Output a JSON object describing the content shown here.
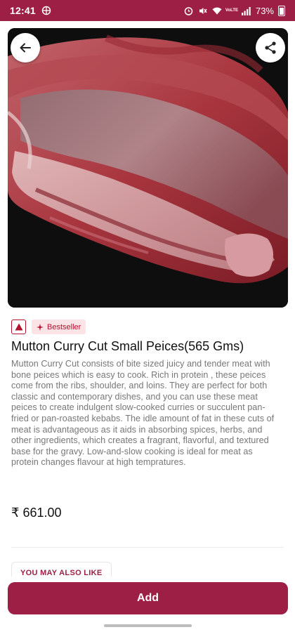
{
  "status_bar": {
    "time": "12:41",
    "battery": "73%",
    "icons": [
      "hotspot-icon",
      "alarm-icon",
      "mute-icon",
      "wifi-icon",
      "volte-icon",
      "signal-icon",
      "battery-icon"
    ]
  },
  "product": {
    "title": "Mutton Curry Cut Small Peices(565 Gms)",
    "badge": "Bestseller",
    "description": "Mutton Curry Cut consists of bite sized juicy and tender meat with bone peices which is easy to cook. Rich in protein , these peices come from the ribs, shoulder, and loins. They are perfect for both classic and contemporary dishes, and you can use these meat peices to create indulgent slow-cooked curries or succulent pan-fried or pan-roasted kebabs. The idle amount of fat in these cuts of meat is advantageous as it aids in absorbing spices, herbs, and other ingredients, which creates a fragrant, flavorful, and textured base for the gravy. Low-and-slow cooking is ideal for meat as protein changes flavour at high tempratures.",
    "price": "₹ 661.00"
  },
  "section": {
    "also_like": "YOU MAY ALSO LIKE"
  },
  "actions": {
    "add_label": "Add"
  },
  "colors": {
    "brand": "#9e1f45",
    "nonveg": "#b3122e",
    "badge_bg": "#fbe3e6"
  }
}
